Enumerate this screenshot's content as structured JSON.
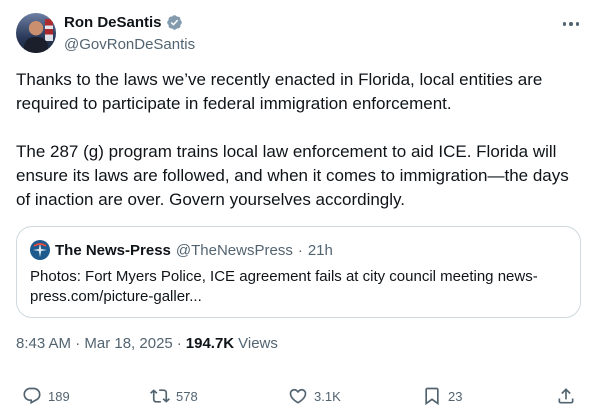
{
  "author": {
    "display_name": "Ron DeSantis",
    "handle": "@GovRonDeSantis",
    "verified_color": "#829aab"
  },
  "tweet": {
    "paragraphs": [
      "Thanks to the laws we’ve recently enacted in Florida, local entities are required to participate in federal immigration enforcement.",
      "The 287 (g) program trains local law enforcement to aid ICE. Florida will ensure its laws are followed, and when it comes to immigration—the days of inaction are over. Govern yourselves accordingly."
    ]
  },
  "quote": {
    "name": "The News-Press",
    "handle": "@TheNewsPress",
    "separator": "·",
    "time": "21h",
    "text": "Photos: Fort Myers Police, ICE agreement fails at city council meeting news-press.com/picture-galler..."
  },
  "meta": {
    "timestamp": "8:43 AM · Mar 18, 2025",
    "separator": "·",
    "views_count": "194.7K",
    "views_label": "Views"
  },
  "actions": {
    "replies": "189",
    "reposts": "578",
    "likes": "3.1K",
    "bookmarks": "23"
  },
  "icons": {
    "verified": "verified-badge-icon",
    "more": "more-horizontal-icon",
    "reply": "reply-icon",
    "repost": "repost-icon",
    "like": "heart-icon",
    "bookmark": "bookmark-icon",
    "share": "share-icon"
  },
  "colors": {
    "text_primary": "#0f1419",
    "text_secondary": "#536471",
    "border": "#cfd9de"
  }
}
